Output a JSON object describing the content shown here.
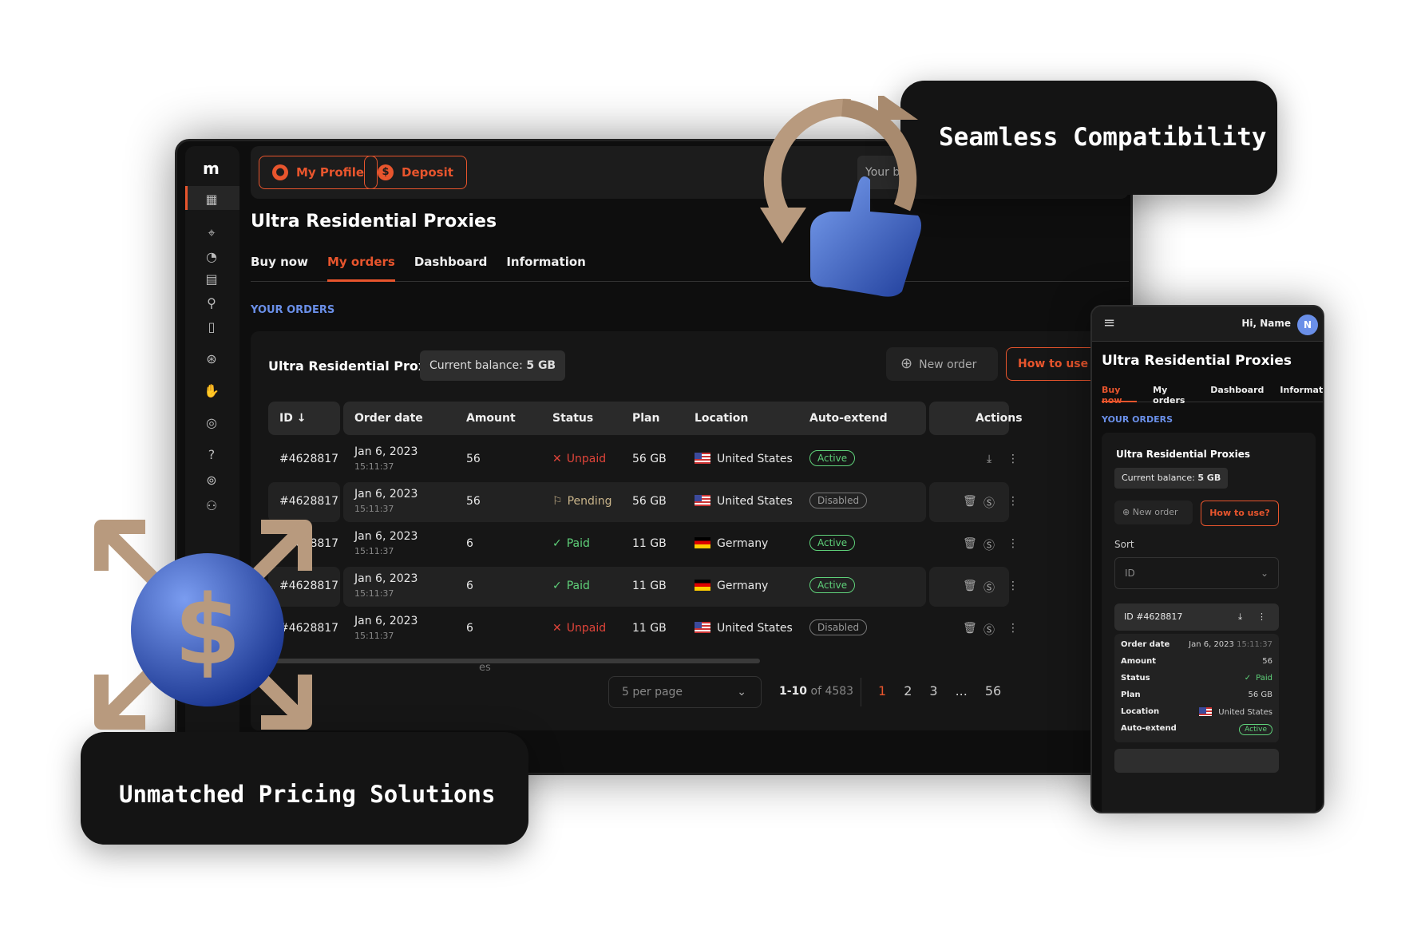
{
  "sidebar": {
    "logo": "m",
    "icons": [
      "dashboard-icon",
      "location-pin-icon",
      "pie-chart-icon",
      "server-icon",
      "user-location-icon",
      "map-pin-document-icon",
      "compass-icon",
      "globe-hand-icon",
      "target-icon",
      "help-icon",
      "network-icon",
      "users-icon"
    ]
  },
  "topbar": {
    "profile_label": "My Profile",
    "deposit_label": "Deposit",
    "balance_partial": "Your b"
  },
  "page": {
    "title": "Ultra Residential Proxies",
    "tabs": [
      "Buy now",
      "My orders",
      "Dashboard",
      "Information"
    ],
    "active_tab": 1,
    "section": "YOUR ORDERS",
    "footer_partial": "es"
  },
  "card": {
    "title": "Ultra Residential Proxies",
    "balance_label": "Current balance:",
    "balance_value": "5 GB",
    "new_order": "New order",
    "how_to_use": "How to use"
  },
  "table": {
    "headers": [
      "ID ↓",
      "Order date",
      "Amount",
      "Status",
      "Plan",
      "Location",
      "Auto-extend",
      "Actions"
    ],
    "rows": [
      {
        "id": "#4628817",
        "date": "Jan 6, 2023",
        "time": "15:11:37",
        "amount": "56",
        "status": "Unpaid",
        "plan": "56 GB",
        "location": "United States",
        "flag": "us",
        "auto": "Active"
      },
      {
        "id": "#4628817",
        "date": "Jan 6, 2023",
        "time": "15:11:37",
        "amount": "56",
        "status": "Pending",
        "plan": "56 GB",
        "location": "United States",
        "flag": "us",
        "auto": "Disabled"
      },
      {
        "id": "#4628817",
        "date": "Jan 6, 2023",
        "time": "15:11:37",
        "amount": "6",
        "status": "Paid",
        "plan": "11 GB",
        "location": "Germany",
        "flag": "de",
        "auto": "Active"
      },
      {
        "id": "#4628817",
        "date": "Jan 6, 2023",
        "time": "15:11:37",
        "amount": "6",
        "status": "Paid",
        "plan": "11 GB",
        "location": "Germany",
        "flag": "de",
        "auto": "Active"
      },
      {
        "id": "#4628817",
        "date": "Jan 6, 2023",
        "time": "15:11:37",
        "amount": "6",
        "status": "Unpaid",
        "plan": "11 GB",
        "location": "United States",
        "flag": "us",
        "auto": "Disabled"
      }
    ]
  },
  "pagination": {
    "per_page": "5 per page",
    "range": "1-10",
    "of": "of 4583",
    "pages": [
      "1",
      "2",
      "3",
      "...",
      "56"
    ],
    "current": "1"
  },
  "phone": {
    "greeting": "Hi, Name",
    "avatar": "N",
    "title": "Ultra Residential Proxies",
    "tabs": [
      "Buy now",
      "My orders",
      "Dashboard",
      "Informati"
    ],
    "section": "YOUR ORDERS",
    "card_title": "Ultra Residential Proxies",
    "balance_label": "Current balance:",
    "balance_value": "5 GB",
    "new_order": "New order",
    "how_to_use": "How to use?",
    "sort_label": "Sort",
    "sort_value": "ID",
    "order_id": "ID #4628817",
    "details": [
      [
        "Order date",
        "Jan 6, 2023",
        "15:11:37"
      ],
      [
        "Amount",
        "56"
      ],
      [
        "Status",
        "Paid"
      ],
      [
        "Plan",
        "56 GB"
      ],
      [
        "Location",
        "United States"
      ],
      [
        "Auto-extend",
        "Active"
      ]
    ]
  },
  "callouts": {
    "top": "Seamless Compatibility",
    "bottom": "Unmatched Pricing Solutions"
  },
  "colors": {
    "accent": "#e8552d",
    "blue": "#6a8fe8",
    "green": "#5fd17a",
    "red": "#e0443a",
    "pending": "#c9b48a",
    "decor_tan": "#b89a7e"
  }
}
